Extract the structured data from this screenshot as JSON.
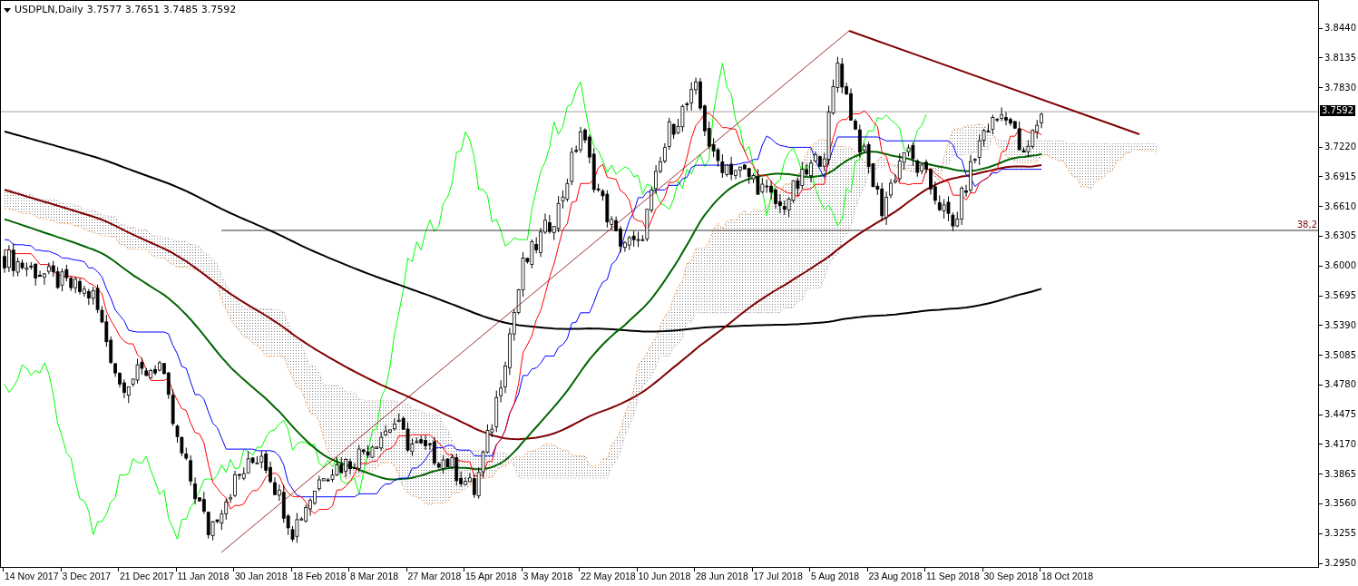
{
  "chart_header": {
    "symbol": "USDPLN,Daily",
    "quote": "3.7577 3.7651 3.7485 3.7592"
  },
  "price_axis": [
    "3.8440",
    "3.8135",
    "3.7830",
    "3.7220",
    "3.6915",
    "3.6610",
    "3.6305",
    "3.6000",
    "3.5695",
    "3.5390",
    "3.5085",
    "3.4780",
    "3.4475",
    "3.4170",
    "3.3865",
    "3.3560",
    "3.3255",
    "3.2950"
  ],
  "current_price": "3.7592",
  "fibonacci_label": "38,2",
  "date_axis": [
    "14 Nov 2017",
    "3 Dec 2017",
    "21 Dec 2017",
    "11 Jan 2018",
    "30 Jan 2018",
    "18 Feb 2018",
    "8 Mar 2018",
    "27 Mar 2018",
    "15 Apr 2018",
    "3 May 2018",
    "22 May 2018",
    "10 Jun 2018",
    "28 Jun 2018",
    "17 Jul 2018",
    "5 Aug 2018",
    "23 Aug 2018",
    "11 Sep 2018",
    "30 Sep 2018",
    "18 Oct 2018"
  ]
}
